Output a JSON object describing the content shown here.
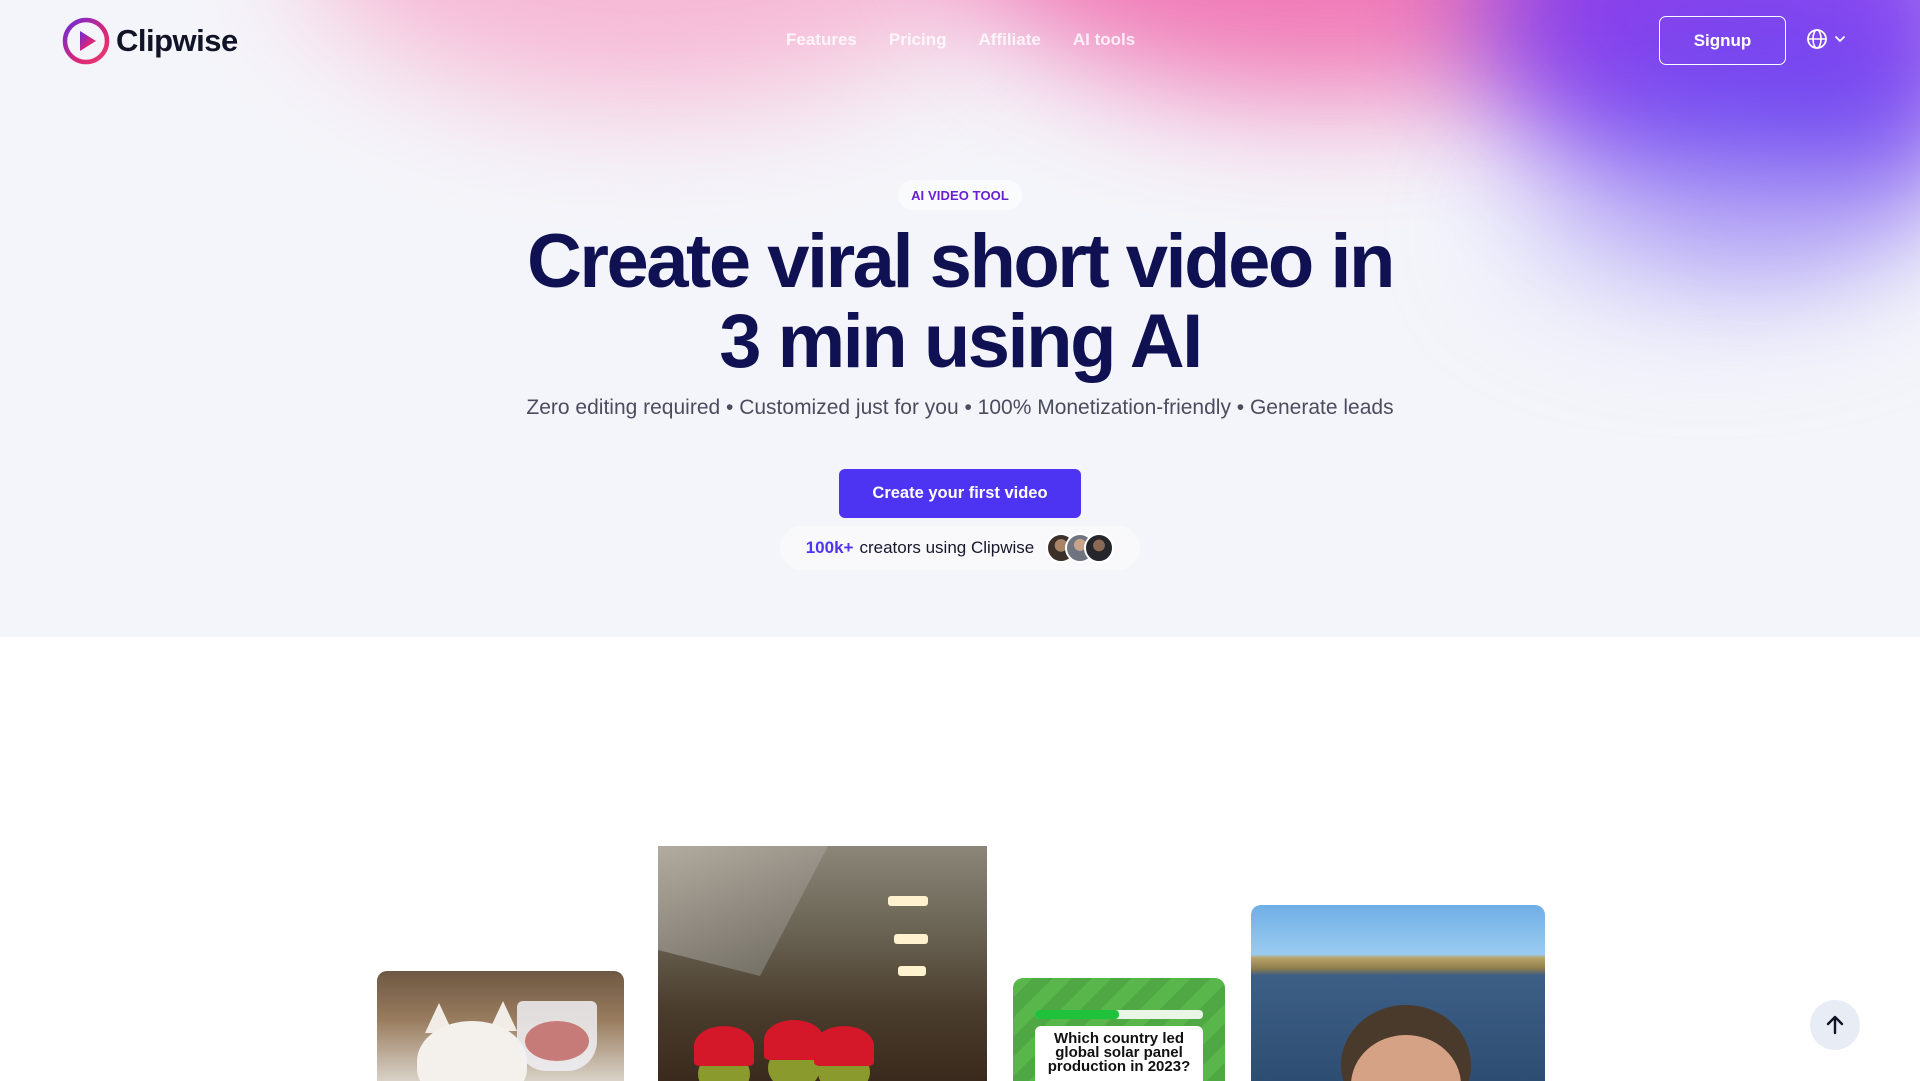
{
  "brand": {
    "name": "Clipwise",
    "logo_icon": "play-circle-icon"
  },
  "nav": {
    "links": [
      "Features",
      "Pricing",
      "Affiliate",
      "AI tools"
    ],
    "signup_label": "Signup",
    "language_icon": "globe-icon"
  },
  "hero": {
    "badge": "AI VIDEO TOOL",
    "headline_line1": "Create viral short video in",
    "headline_line2": "3 min using AI",
    "subline": "Zero editing required • Customized just for you • 100% Monetization-friendly • Generate leads",
    "cta_label": "Create your first video",
    "creators_count": "100k+",
    "creators_text": "creators using Clipwise"
  },
  "showcase": {
    "quiz_question": "Which country led global solar panel production in 2023?",
    "quiz_progress": 0.5
  },
  "colors": {
    "brand_accent": "#4d34f2",
    "heading": "#0f1152",
    "badge_text": "#6a1fd0"
  },
  "scroll_top_icon": "arrow-up-icon"
}
